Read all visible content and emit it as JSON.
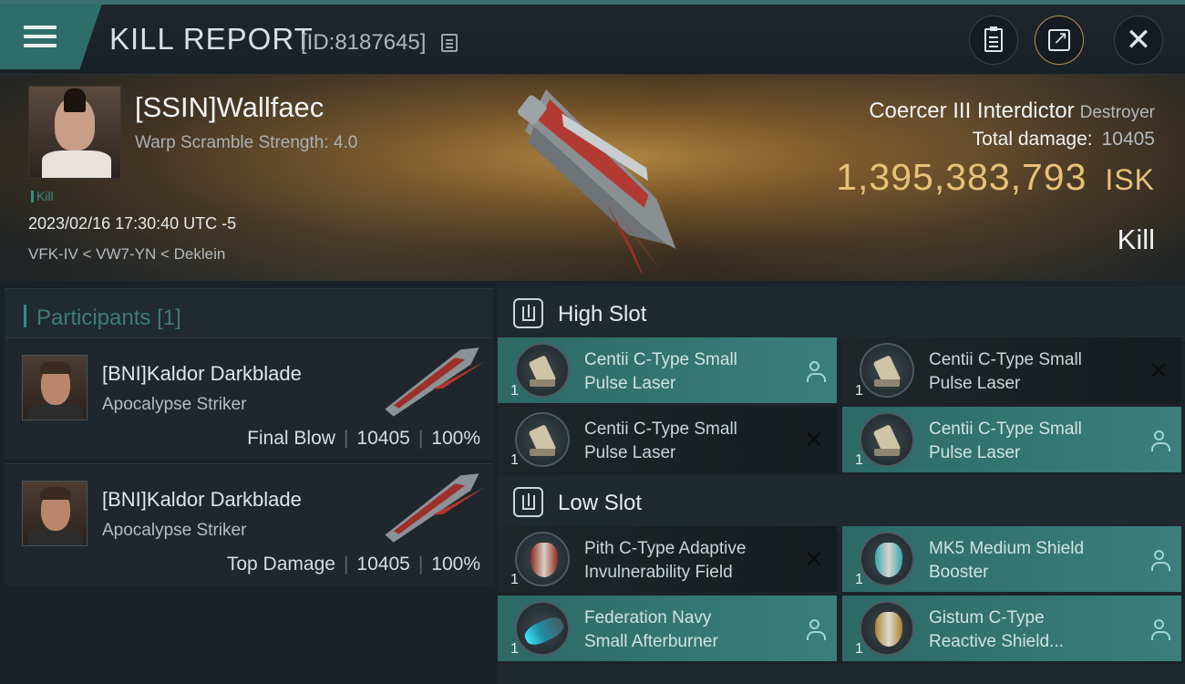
{
  "header": {
    "title": "KILL REPORT",
    "report_id": "[ID:8187645]",
    "icons": {
      "menu": "hamburger-menu-icon",
      "copy": "copy-icon",
      "report": "clipboard-icon",
      "share": "share-icon",
      "close": "close-icon"
    }
  },
  "victim": {
    "name": "[SSIN]Wallfaec",
    "warp_scramble": "Warp Scramble Strength: 4.0",
    "tag": "Kill",
    "timestamp": "2023/02/16 17:30:40 UTC -5",
    "location": "VFK-IV < VW7-YN < Deklein",
    "ship_name": "Coercer III Interdictor",
    "ship_class": "Destroyer",
    "total_damage_label": "Total damage:",
    "total_damage": "10405",
    "isk_value": "1,395,383,793",
    "isk_unit": "ISK",
    "result": "Kill"
  },
  "participants": {
    "label": "Participants",
    "count": "[1]",
    "items": [
      {
        "name": "[BNI]Kaldor Darkblade",
        "ship": "Apocalypse Striker",
        "role": "Final Blow",
        "damage": "10405",
        "percent": "100%",
        "sep": "|"
      },
      {
        "name": "[BNI]Kaldor Darkblade",
        "ship": "Apocalypse Striker",
        "role": "Top Damage",
        "damage": "10405",
        "percent": "100%",
        "sep": "|"
      }
    ]
  },
  "fitting": {
    "high_slot": {
      "title": "High Slot",
      "modules": [
        {
          "line1": "Centii C-Type Small",
          "line2": "Pulse Laser",
          "qty": "1",
          "state": "dropped"
        },
        {
          "line1": "Centii C-Type Small",
          "line2": "Pulse Laser",
          "qty": "1",
          "state": "destroyed"
        },
        {
          "line1": "Centii C-Type Small",
          "line2": "Pulse Laser",
          "qty": "1",
          "state": "destroyed"
        },
        {
          "line1": "Centii C-Type Small",
          "line2": "Pulse Laser",
          "qty": "1",
          "state": "dropped"
        }
      ]
    },
    "low_slot": {
      "title": "Low Slot",
      "modules": [
        {
          "line1": "Pith C-Type Adaptive",
          "line2": "Invulnerability Field",
          "qty": "1",
          "state": "destroyed"
        },
        {
          "line1": "MK5 Medium Shield",
          "line2": "Booster",
          "qty": "1",
          "state": "dropped"
        },
        {
          "line1": "Federation Navy",
          "line2": "Small Afterburner",
          "qty": "1",
          "state": "dropped"
        },
        {
          "line1": "Gistum C-Type",
          "line2": "Reactive Shield...",
          "qty": "1",
          "state": "dropped"
        }
      ]
    }
  },
  "colors": {
    "accent_teal": "#3a7f7c",
    "isk_gold": "#e7c178",
    "share_ring": "#b89153"
  }
}
